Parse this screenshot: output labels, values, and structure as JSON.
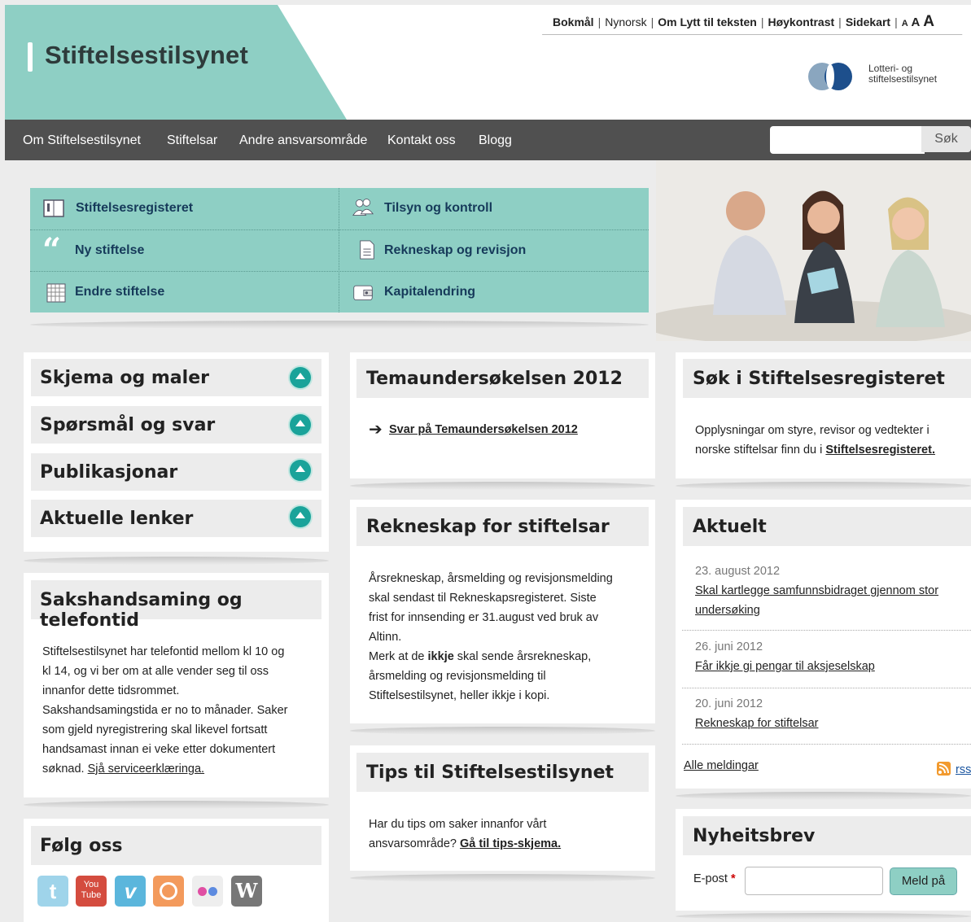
{
  "header": {
    "site_title": "Stiftelsestilsynet",
    "toolbar": {
      "bokmal": "Bokmål",
      "nynorsk": "Nynorsk",
      "lytt": "Om Lytt til teksten",
      "hoykontrast": "Høykontrast",
      "sidekart": "Sidekart",
      "font_small": "A",
      "font_medium": "A",
      "font_large": "A"
    },
    "partner_logo_line1": "Lotteri- og",
    "partner_logo_line2": "stiftelsestilsynet"
  },
  "nav": {
    "items": [
      "Om Stiftelsestilsynet",
      "Stiftelsar",
      "Andre ansvarsområde",
      "Kontakt oss",
      "Blogg"
    ],
    "search_button": "Søk",
    "search_placeholder": ""
  },
  "quick_links": [
    {
      "label": "Stiftelsesregisteret",
      "icon": "book-icon"
    },
    {
      "label": "Tilsyn og kontroll",
      "icon": "people-icon"
    },
    {
      "label": "Ny stiftelse",
      "icon": "quote-icon"
    },
    {
      "label": "Rekneskap og revisjon",
      "icon": "document-icon"
    },
    {
      "label": "Endre stiftelse",
      "icon": "grid-icon"
    },
    {
      "label": "Kapitalendring",
      "icon": "wallet-icon"
    }
  ],
  "accordion": [
    "Skjema og maler",
    "Spørsmål og svar",
    "Publikasjonar",
    "Aktuelle lenker"
  ],
  "saksbehandling": {
    "title": "Sakshandsaming og telefontid",
    "lines": [
      "Stiftelsestilsynet har telefontid mellom kl 10 og",
      "kl 14, og vi ber om at alle vender seg til oss",
      "innanfor dette tidsrommet.",
      "Sakshandsamingstida er no to månader. Saker",
      "som gjeld nyregistrering skal likevel fortsatt",
      "handsamast innan ei veke etter dokumentert",
      "søknad. "
    ],
    "link": "Sjå serviceerklæringa."
  },
  "follow": {
    "title": "Følg oss",
    "youtube_label1": "You",
    "youtube_label2": "Tube"
  },
  "tema": {
    "title": "Temaundersøkelsen 2012",
    "link": "Svar på Temaundersøkelsen 2012"
  },
  "rekneskap": {
    "title": "Rekneskap for stiftelsar",
    "lines": [
      "Årsrekneskap, årsmelding og revisjonsmelding",
      "skal sendast til Rekneskapsregisteret. Siste",
      "frist for innsending er 31.august ved bruk av",
      "Altinn."
    ],
    "line5_pre": "Merk at de ",
    "line5_bold": "ikkje",
    "line5_post": " skal sende årsrekneskap,",
    "line6": "årsmelding og revisjonsmelding til",
    "line7": "Stiftelsestilsynet, heller ikkje i kopi."
  },
  "tips": {
    "title": "Tips til Stiftelsestilsynet",
    "line1": "Har du tips om saker innanfor vårt",
    "line2_pre": "ansvarsområde? ",
    "link": "Gå til tips-skjema."
  },
  "sok_register": {
    "title": "Søk i Stiftelsesregisteret",
    "line1": "Opplysningar om styre, revisor og vedtekter i",
    "line2_pre": "norske stiftelsar finn du i ",
    "link": "Stiftelsesregisteret."
  },
  "aktuelt": {
    "title": "Aktuelt",
    "items": [
      {
        "date": "23. august 2012",
        "line1": "Skal kartlegge samfunnsbidraget gjennom stor",
        "line2": "undersøking"
      },
      {
        "date": "26. juni 2012",
        "line1": "Får ikkje gi pengar til aksjeselskap",
        "line2": ""
      },
      {
        "date": "20. juni 2012",
        "line1": "Rekneskap for stiftelsar",
        "line2": ""
      }
    ],
    "all_link": "Alle meldingar",
    "rss_label": "rss"
  },
  "newsletter": {
    "title": "Nyheitsbrev",
    "email_label": "E-post",
    "required_mark": "*",
    "button": "Meld på"
  },
  "colors": {
    "teal": "#8ecfc4",
    "nav_bg": "#505050",
    "accent_button": "#1aa39a"
  }
}
